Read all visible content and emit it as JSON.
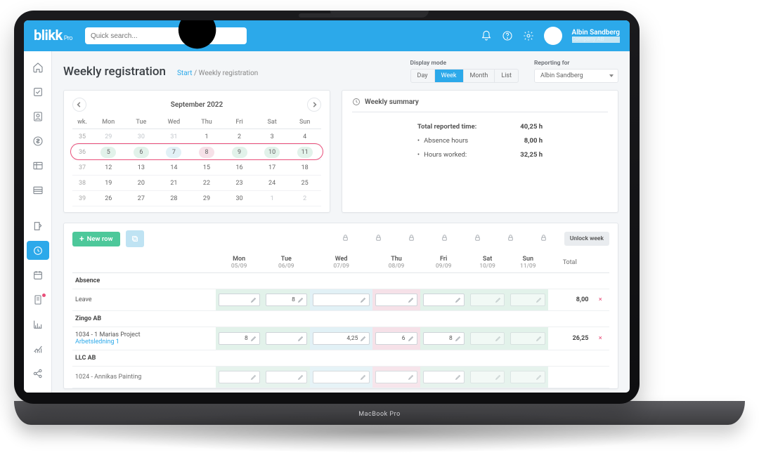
{
  "brand": {
    "name": "blikk",
    "suffix": "Pro"
  },
  "search": {
    "placeholder": "Quick search..."
  },
  "user": {
    "name": "Albin Sandberg",
    "company": "Company AB"
  },
  "page": {
    "title": "Weekly registration",
    "breadcrumb_start": "Start",
    "breadcrumb_current": "Weekly registration"
  },
  "display_mode": {
    "label": "Display mode",
    "options": [
      "Day",
      "Week",
      "Month",
      "List"
    ],
    "selected": "Week"
  },
  "reporting_for": {
    "label": "Reporting for",
    "value": "Albin Sandberg"
  },
  "calendar": {
    "month": "September 2022",
    "dow": [
      "wk.",
      "Mon",
      "Tue",
      "Wed",
      "Thu",
      "Fri",
      "Sat",
      "Sun"
    ],
    "rows": [
      {
        "wk": 35,
        "days": [
          [
            "29",
            "m"
          ],
          [
            "30",
            "m"
          ],
          [
            "31",
            "m"
          ],
          [
            "1",
            ""
          ],
          [
            "2",
            ""
          ],
          [
            "3",
            ""
          ],
          [
            "4",
            ""
          ]
        ]
      },
      {
        "wk": 36,
        "sel": true,
        "days": [
          [
            "5",
            "g"
          ],
          [
            "6",
            "g"
          ],
          [
            "7",
            "c"
          ],
          [
            "8",
            "p"
          ],
          [
            "9",
            "g"
          ],
          [
            "10",
            "g"
          ],
          [
            "11",
            "g"
          ]
        ]
      },
      {
        "wk": 37,
        "days": [
          [
            "12",
            ""
          ],
          [
            "13",
            ""
          ],
          [
            "14",
            ""
          ],
          [
            "15",
            ""
          ],
          [
            "16",
            ""
          ],
          [
            "17",
            ""
          ],
          [
            "18",
            ""
          ]
        ]
      },
      {
        "wk": 38,
        "days": [
          [
            "19",
            ""
          ],
          [
            "20",
            ""
          ],
          [
            "21",
            ""
          ],
          [
            "22",
            ""
          ],
          [
            "23",
            ""
          ],
          [
            "24",
            ""
          ],
          [
            "25",
            ""
          ]
        ]
      },
      {
        "wk": 39,
        "days": [
          [
            "26",
            ""
          ],
          [
            "27",
            ""
          ],
          [
            "28",
            ""
          ],
          [
            "29",
            ""
          ],
          [
            "30",
            ""
          ],
          [
            "1",
            "m"
          ],
          [
            "2",
            "m"
          ]
        ]
      }
    ]
  },
  "summary": {
    "title": "Weekly summary",
    "rows": [
      {
        "label": "Total reported time:",
        "value": "40,25 h",
        "bold": true
      },
      {
        "label": "Absence hours",
        "value": "8,00 h",
        "bullet": true
      },
      {
        "label": "Hours worked:",
        "value": "32,25 h",
        "bullet": true
      }
    ]
  },
  "grid": {
    "new_row": "New row",
    "unlock": "Unlock week",
    "days": [
      {
        "d": "Mon",
        "date": "05/09",
        "tint": "g"
      },
      {
        "d": "Tue",
        "date": "06/09",
        "tint": "g"
      },
      {
        "d": "Wed",
        "date": "07/09",
        "tint": "c"
      },
      {
        "d": "Thu",
        "date": "08/09",
        "tint": "p"
      },
      {
        "d": "Fri",
        "date": "09/09",
        "tint": "g"
      },
      {
        "d": "Sat",
        "date": "10/09",
        "tint": "g"
      },
      {
        "d": "Sun",
        "date": "11/09",
        "tint": "g"
      }
    ],
    "total_label": "Total",
    "sections": [
      {
        "title": "Absence",
        "rows": [
          {
            "label": "Leave",
            "cells": [
              "",
              "8",
              "",
              "",
              "",
              "",
              ""
            ],
            "off": [
              false,
              false,
              false,
              false,
              false,
              true,
              true
            ],
            "total": "8,00"
          }
        ]
      },
      {
        "title": "Zingo AB",
        "rows": [
          {
            "label": "1034 - 1 Marias Project",
            "sublink": "Arbetsledning 1",
            "cells": [
              "8",
              "",
              "4,25",
              "6",
              "8",
              "",
              ""
            ],
            "off": [
              false,
              false,
              false,
              false,
              false,
              true,
              true
            ],
            "total": "26,25"
          }
        ]
      },
      {
        "title": "LLC AB",
        "rows": [
          {
            "label": "1024 - Annikas Painting",
            "cells": [
              "",
              "",
              "",
              "",
              "",
              "",
              ""
            ],
            "off": [
              false,
              false,
              false,
              false,
              false,
              true,
              true
            ],
            "total": "",
            "cut": true
          }
        ]
      }
    ]
  },
  "base_text": "MacBook Pro"
}
